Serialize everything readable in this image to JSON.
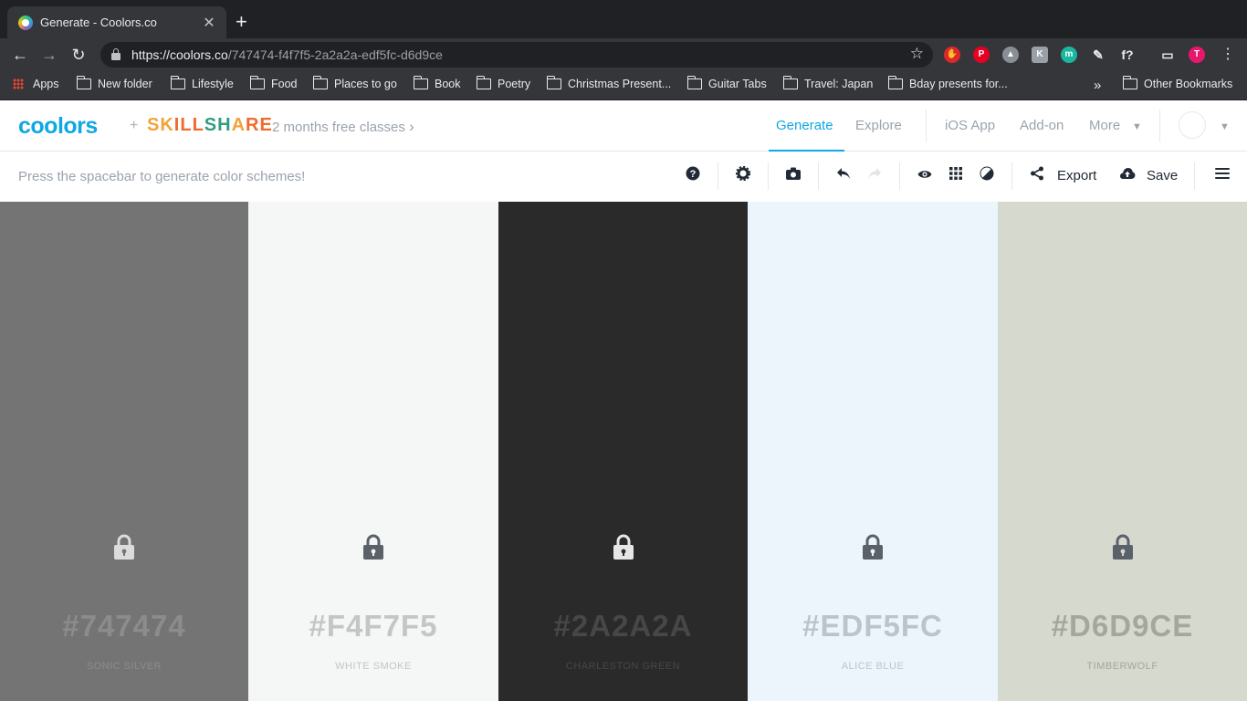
{
  "browser": {
    "tab_title": "Generate - Coolors.co",
    "new_tab_symbol": "+",
    "url_host": "https://coolors.co",
    "url_path": "/747474-f4f7f5-2a2a2a-edf5fc-d6d9ce",
    "extensions": [
      {
        "name": "adblock-icon",
        "color": "#e0262b",
        "glyph": "✋"
      },
      {
        "name": "pinterest-icon",
        "color": "#e60023",
        "glyph": "P"
      },
      {
        "name": "drive-icon",
        "color": "#8a8f96",
        "glyph": "▲"
      },
      {
        "name": "kami-icon",
        "color": "#9aa0a6",
        "glyph": "K"
      },
      {
        "name": "mendeley-icon",
        "color": "#1ab7a0",
        "glyph": "m"
      },
      {
        "name": "pen-icon",
        "color": "#35363a",
        "glyph": "✎"
      },
      {
        "name": "formula-icon",
        "color": "#35363a",
        "glyph": "f?"
      },
      {
        "name": "cast-icon",
        "color": "#35363a",
        "glyph": "▭"
      },
      {
        "name": "profile-avatar",
        "color": "#e8176b",
        "glyph": "T"
      }
    ],
    "bookmarks": [
      "Apps",
      "New folder",
      "Lifestyle",
      "Food",
      "Places to go",
      "Book",
      "Poetry",
      "Christmas Present...",
      "Guitar Tabs",
      "Travel: Japan",
      "Bday presents for...",
      "Other Bookmarks"
    ],
    "overflow_symbol": "»"
  },
  "header": {
    "logo": "coolors",
    "plus": "+",
    "partner_letters": [
      {
        "ch": "S",
        "color": "#f2a33a"
      },
      {
        "ch": "K",
        "color": "#f2a33a"
      },
      {
        "ch": "I",
        "color": "#ef6a2b"
      },
      {
        "ch": "L",
        "color": "#ef6a2b"
      },
      {
        "ch": "L",
        "color": "#ef6a2b"
      },
      {
        "ch": "S",
        "color": "#2f9d7f"
      },
      {
        "ch": "H",
        "color": "#2f9d7f"
      },
      {
        "ch": "A",
        "color": "#f2a33a"
      },
      {
        "ch": "R",
        "color": "#ef6a2b"
      },
      {
        "ch": "E",
        "color": "#ef6a2b"
      }
    ],
    "promo": "2 months free classes",
    "promo_arrow": "›",
    "nav": {
      "generate": "Generate",
      "explore": "Explore",
      "ios_app": "iOS App",
      "addon": "Add-on",
      "more": "More"
    }
  },
  "toolbar": {
    "hint": "Press the spacebar to generate color schemes!",
    "export_label": "Export",
    "save_label": "Save"
  },
  "palette": [
    {
      "hex": "#747474",
      "name": "SONIC SILVER",
      "bg": "#747474",
      "text": "#8c8c8c",
      "lock": "#dcdcdc"
    },
    {
      "hex": "#F4F7F5",
      "name": "WHITE SMOKE",
      "bg": "#f4f7f5",
      "text": "#c2c6c4",
      "lock": "#5b6169"
    },
    {
      "hex": "#2A2A2A",
      "name": "CHARLESTON GREEN",
      "bg": "#2a2a2a",
      "text": "#474747",
      "lock": "#e6e6e6"
    },
    {
      "hex": "#EDF5FC",
      "name": "ALICE BLUE",
      "bg": "#edf5fc",
      "text": "#bcc4cb",
      "lock": "#5b6169"
    },
    {
      "hex": "#D6D9CE",
      "name": "TIMBERWOLF",
      "bg": "#d6d9ce",
      "text": "#a4a79e",
      "lock": "#5b6169"
    }
  ],
  "colors": {
    "accent": "#0fa8e2"
  }
}
